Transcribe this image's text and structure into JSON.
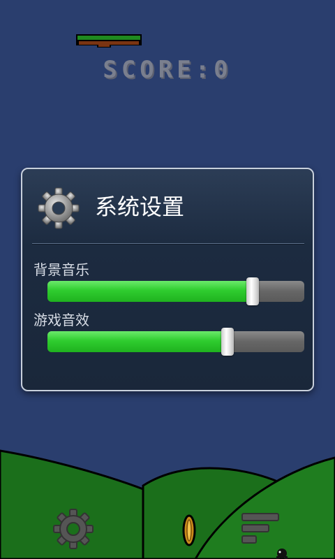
{
  "score": {
    "text": "SCORE:0"
  },
  "dialog": {
    "title": "系统设置",
    "icon": "gear-icon",
    "settings": [
      {
        "label": "背景音乐",
        "value": 0.8
      },
      {
        "label": "游戏音效",
        "value": 0.7
      }
    ]
  },
  "bottom_bar": {
    "settings_icon": "gear-icon",
    "coin_icon": "coin-icon",
    "leaderboard_icon": "leaderboard-icon"
  },
  "colors": {
    "background": "#2a3e6e",
    "hill": "#1c7a1c",
    "slider_fill": "#2fcd2f",
    "slider_track": "#666666"
  }
}
